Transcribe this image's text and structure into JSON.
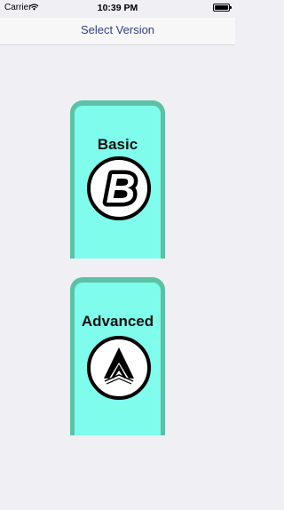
{
  "status_bar": {
    "carrier": "Carrier",
    "time": "10:39 PM"
  },
  "nav": {
    "title": "Select Version"
  },
  "versions": [
    {
      "label": "Basic",
      "emblem_letter": "B",
      "icon": "letter-b-emblem-icon"
    },
    {
      "label": "Advanced",
      "icon": "chevron-up-emblem-icon"
    }
  ],
  "colors": {
    "card_border": "#5bc2a6",
    "card_fill": "#7ffcec",
    "nav_title": "#2f3f86",
    "background": "#efeff4"
  }
}
